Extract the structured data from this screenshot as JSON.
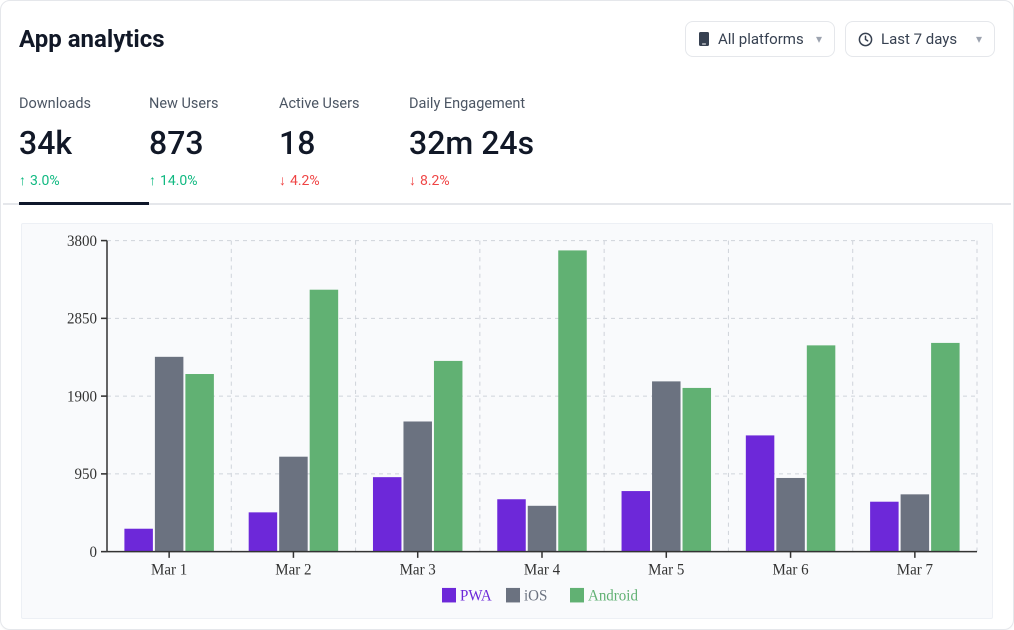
{
  "header": {
    "title": "App analytics"
  },
  "filters": {
    "platform": {
      "label": "All platforms"
    },
    "range": {
      "label": "Last 7 days"
    }
  },
  "metrics": [
    {
      "key": "downloads",
      "label": "Downloads",
      "value": "34k",
      "delta": "3.0%",
      "dir": "up"
    },
    {
      "key": "new_users",
      "label": "New Users",
      "value": "873",
      "delta": "14.0%",
      "dir": "up"
    },
    {
      "key": "active",
      "label": "Active Users",
      "value": "18",
      "delta": "4.2%",
      "dir": "down"
    },
    {
      "key": "engagement",
      "label": "Daily Engagement",
      "value": "32m 24s",
      "delta": "8.2%",
      "dir": "down"
    }
  ],
  "legend": {
    "pwa": "PWA",
    "ios": "iOS",
    "android": "Android"
  },
  "colors": {
    "pwa": "#6d28d9",
    "ios": "#6b7280",
    "android": "#61b173"
  },
  "chart_data": {
    "type": "bar",
    "title": "",
    "xlabel": "",
    "ylabel": "",
    "ylim": [
      0,
      3800
    ],
    "yticks": [
      0,
      950,
      1900,
      2850,
      3800
    ],
    "categories": [
      "Mar 1",
      "Mar 2",
      "Mar 3",
      "Mar 4",
      "Mar 5",
      "Mar 6",
      "Mar 7"
    ],
    "series": [
      {
        "name": "PWA",
        "color": "#6d28d9",
        "values": [
          280,
          480,
          910,
          640,
          740,
          1420,
          610
        ]
      },
      {
        "name": "iOS",
        "color": "#6b7280",
        "values": [
          2380,
          1160,
          1590,
          560,
          2080,
          900,
          700
        ]
      },
      {
        "name": "Android",
        "color": "#61b173",
        "values": [
          2170,
          3200,
          2330,
          3680,
          2000,
          2520,
          2550
        ]
      }
    ]
  }
}
